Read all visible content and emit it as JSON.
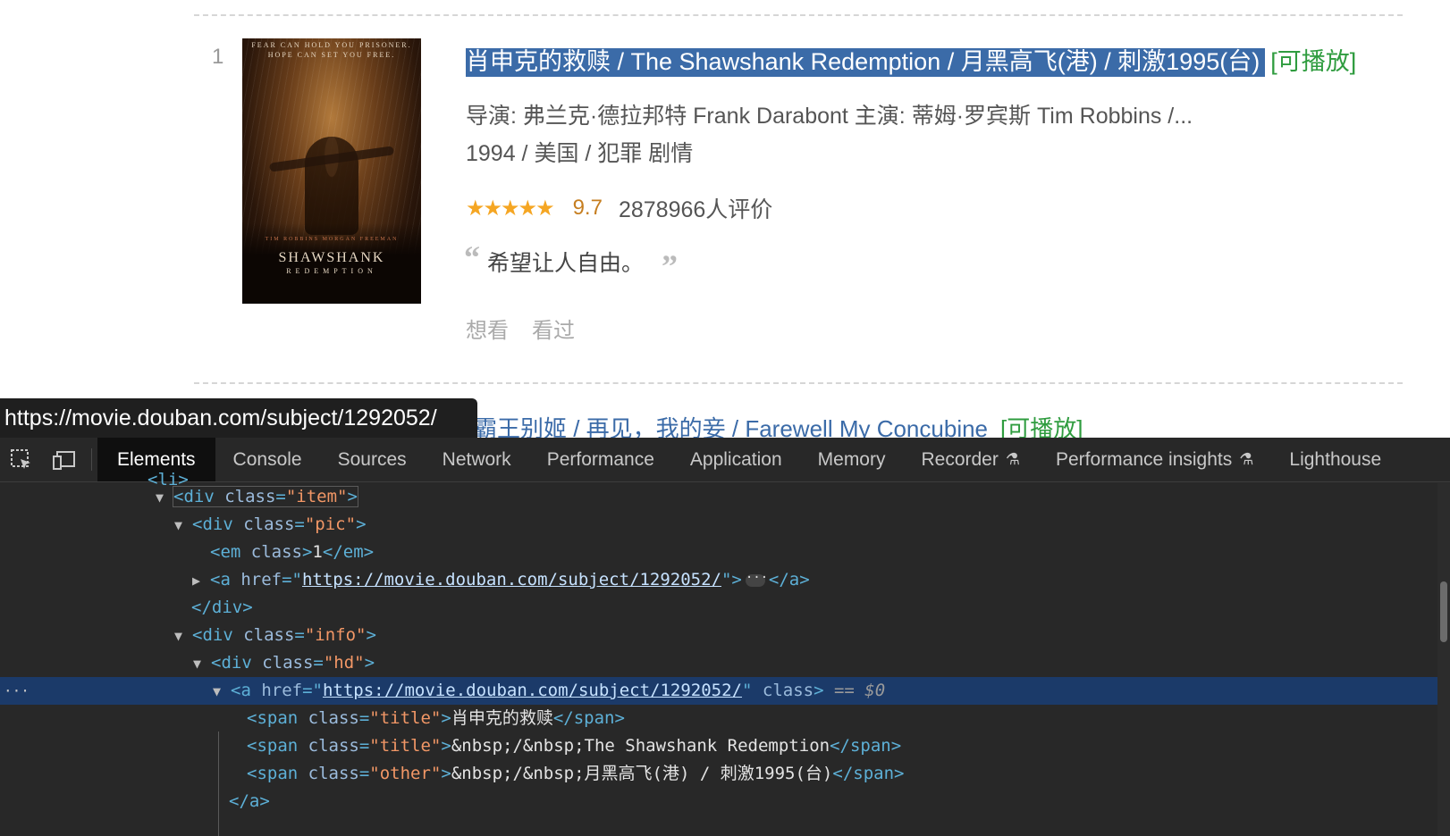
{
  "movie": {
    "rank": "1",
    "poster_tagline_1": "FEAR CAN HOLD YOU PRISONER.",
    "poster_tagline_2": "HOPE CAN SET YOU FREE.",
    "poster_cast": "TIM ROBBINS     MORGAN FREEMAN",
    "poster_title": "SHAWSHANK",
    "poster_subtitle": "REDEMPTION",
    "title_selected": "肖申克的救赎  / The Shawshank Redemption  / 月黑高飞(港) / 刺激1995(台)",
    "playable": "[可播放]",
    "director_line": "导演: 弗兰克·德拉邦特 Frank Darabont   主演: 蒂姆·罗宾斯 Tim Robbins /...",
    "info_line": "1994 / 美国 / 犯罪 剧情",
    "stars": "★★★★★",
    "score": "9.7",
    "votes": "2878966人评价",
    "quote_open": "“",
    "quote": "希望让人自由。",
    "quote_close": "”",
    "want_label": "想看",
    "seen_label": "看过"
  },
  "next_movie": {
    "title": "霸王别姬  / 再见，我的妾 / Farewell My Concubine",
    "playable": "[可播放]"
  },
  "status_url": "https://movie.douban.com/subject/1292052/",
  "devtools": {
    "tabs": [
      "Elements",
      "Console",
      "Sources",
      "Network",
      "Performance",
      "Application",
      "Memory",
      "Recorder",
      "Performance insights",
      "Lighthouse"
    ],
    "flask_glyph": "⚗",
    "dom": {
      "li_partial": "<li>",
      "div_item_tag": "<div ",
      "div_item_attr": "class",
      "div_item_val": "\"item\"",
      "div_pic_tag": "<div ",
      "div_pic_attr": "class",
      "div_pic_val": "\"pic\"",
      "em_open": "<em ",
      "em_attr": "class",
      "em_text": "1",
      "em_close": "</em>",
      "a_open": "<a ",
      "a_attr": "href",
      "a_href": "https://movie.douban.com/subject/1292052/",
      "a_close": "</a>",
      "div_close": "</div>",
      "div_info_tag": "<div ",
      "div_info_attr": "class",
      "div_info_val": "\"info\"",
      "div_hd_tag": "<div ",
      "div_hd_attr": "class",
      "div_hd_val": "\"hd\"",
      "sel_a_attr2": "class",
      "sel_marker": "== $0",
      "span_attr": "class",
      "span_title_val": "\"title\"",
      "span_other_val": "\"other\"",
      "span1_text": "肖申克的救赎",
      "span2_text": "&nbsp;/&nbsp;The Shawshank Redemption",
      "span3_text": "&nbsp;/&nbsp;月黑高飞(港) / 刺激1995(台)",
      "span_close": "</span>",
      "a_end": "</a>"
    }
  }
}
